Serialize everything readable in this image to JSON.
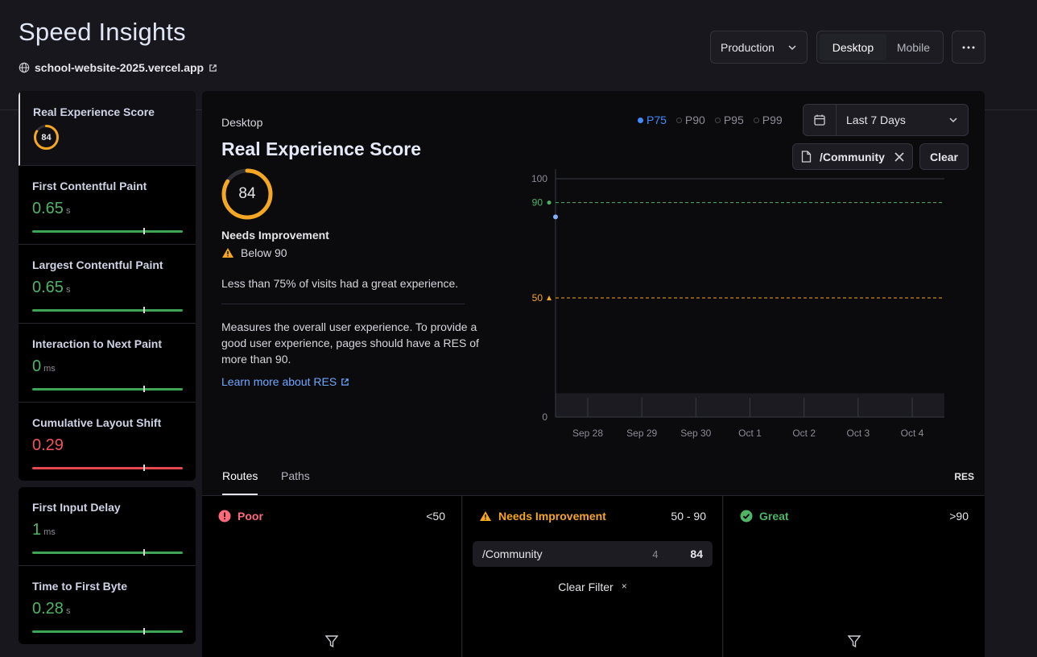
{
  "header": {
    "title": "Speed Insights",
    "site": "school-website-2025.vercel.app",
    "environment": "Production",
    "devices": [
      "Desktop",
      "Mobile"
    ],
    "active_device": "Desktop"
  },
  "sidebar": {
    "metrics": [
      {
        "name": "Real Experience Score",
        "value": "84",
        "unit": ""
      },
      {
        "name": "First Contentful Paint",
        "value": "0.65",
        "unit": "s"
      },
      {
        "name": "Largest Contentful Paint",
        "value": "0.65",
        "unit": "s"
      },
      {
        "name": "Interaction to Next Paint",
        "value": "0",
        "unit": "ms"
      },
      {
        "name": "Cumulative Layout Shift",
        "value": "0.29",
        "unit": ""
      }
    ],
    "extra_metrics": [
      {
        "name": "First Input Delay",
        "value": "1",
        "unit": "ms"
      },
      {
        "name": "Time to First Byte",
        "value": "0.28",
        "unit": "s"
      }
    ]
  },
  "panel": {
    "device": "Desktop",
    "title": "Real Experience Score",
    "score": "84",
    "score_fraction": 0.84,
    "status": "Needs Improvement",
    "threshold_note": "Below 90",
    "summary": "Less than 75% of visits had a great experience.",
    "description": "Measures the overall user experience. To provide a good user experience, pages should have a RES of more than 90.",
    "learn_more": "Learn more about RES",
    "percentiles": [
      "P75",
      "P90",
      "P95",
      "P99"
    ],
    "active_percentile": "P75",
    "date_range": "Last 7 Days",
    "filter": "/Community",
    "clear": "Clear"
  },
  "chart_data": {
    "type": "line",
    "x": [
      "Sep 28",
      "Sep 29",
      "Sep 30",
      "Oct 1",
      "Oct 2",
      "Oct 3",
      "Oct 4"
    ],
    "ylim": [
      0,
      100
    ],
    "yticks": [
      "100",
      "90",
      "50",
      "0"
    ],
    "thresholds": [
      {
        "label": "90",
        "value": 90,
        "color": "#4fb466"
      },
      {
        "label": "50",
        "value": 50,
        "color": "#f5a623"
      }
    ],
    "series": [
      {
        "values": [
          84
        ],
        "color": "#7fb0ff"
      }
    ]
  },
  "tabs": {
    "items": [
      "Routes",
      "Paths"
    ],
    "active": "Routes",
    "right_label": "RES"
  },
  "buckets": [
    {
      "label": "Poor",
      "range": "<50"
    },
    {
      "label": "Needs Improvement",
      "range": "50 - 90"
    },
    {
      "label": "Great",
      "range": ">90"
    }
  ],
  "route": {
    "path": "/Community",
    "count": "4",
    "score": "84"
  },
  "clear_filter": "Clear Filter",
  "clear_filter_icon": "×"
}
